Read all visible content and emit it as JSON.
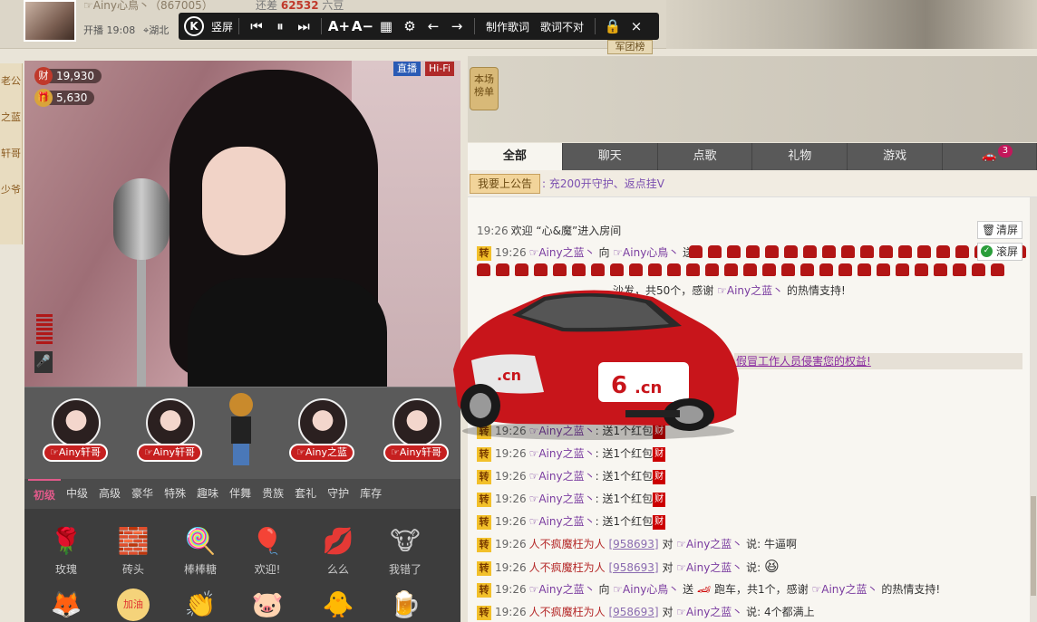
{
  "header": {
    "host_name": "☞Ainy心鳥丶（867005）",
    "open_label": "开播",
    "open_time": "19:08",
    "location": "湖北",
    "diff_prefix": "还差",
    "diff_value": "62532",
    "diff_suffix": "六豆",
    "army_label": "军团榜"
  },
  "lyric_toolbar": {
    "k_label": "K",
    "vertical_label": "竖屏",
    "make_lyric": "制作歌词",
    "lyric_wrong": "歌词不对",
    "close": "×"
  },
  "left_strip": [
    "老公",
    "之蓝",
    "轩哥",
    "少爷"
  ],
  "video": {
    "wealth_icon": "财",
    "wealth": "19,930",
    "gift_count": "5,630",
    "live_tag": "直播",
    "hifi_tag": "Hi-Fi"
  },
  "guards": [
    {
      "name": "☞Ainy轩哥"
    },
    {
      "name": "☞Ainy轩哥"
    },
    {
      "name": "☞Ainy之蓝"
    },
    {
      "name": "☞Ainy轩哥"
    }
  ],
  "gift_tabs": [
    "初级",
    "中级",
    "高级",
    "豪华",
    "特殊",
    "趣味",
    "伴舞",
    "贵族",
    "套礼",
    "守护",
    "库存"
  ],
  "gifts_row1": [
    {
      "icon": "rose-icon",
      "glyph": "🌹",
      "label": "玫瑰"
    },
    {
      "icon": "brick-icon",
      "glyph": "🧱",
      "label": "砖头"
    },
    {
      "icon": "lollipop-icon",
      "glyph": "🍭",
      "label": "棒棒糖"
    },
    {
      "icon": "welcome-icon",
      "glyph": "🎈",
      "label": "欢迎!"
    },
    {
      "icon": "kiss-icon",
      "glyph": "💋",
      "label": "么么"
    },
    {
      "icon": "cow-icon",
      "glyph": "🐮",
      "label": "我错了"
    }
  ],
  "gifts_row2": [
    {
      "icon": "fox-icon",
      "glyph": "🦊"
    },
    {
      "icon": "cheer-icon",
      "glyph": "加油"
    },
    {
      "icon": "clap-icon",
      "glyph": "👏"
    },
    {
      "icon": "pig-icon",
      "glyph": "🐷"
    },
    {
      "icon": "duck-icon",
      "glyph": "🐥"
    },
    {
      "icon": "beer-icon",
      "glyph": "🍺"
    }
  ],
  "right": {
    "rank_label": "本场榜单",
    "tabs": [
      "全部",
      "聊天",
      "点歌",
      "礼物",
      "游戏"
    ],
    "car_count": "3",
    "announce_btn": "我要上公告",
    "announce_text": "充200开守护、返点挂V",
    "clear_btn": "清屏",
    "scroll_btn": "滚屏",
    "warning": "假冒工作人员侵害您的权益!"
  },
  "chat": {
    "welcome": {
      "time": "19:26",
      "text": "欢迎 “心&魔”进入房间"
    },
    "seat_send": {
      "zhuan": "转",
      "time": "19:26",
      "from": "☞Ainy之蓝丶",
      "to_word": "向",
      "to": "☞Ainy心鳥丶",
      "send": "送"
    },
    "seat_summary": {
      "text_a": "沙发，共50个，感谢",
      "user": "☞Ainy之蓝丶",
      "text_b": "的热情支持!"
    },
    "redpack_lines": [
      {
        "zhuan": "转",
        "time": "19:26",
        "user": "☞Ainy之蓝丶",
        "text": "送1个红包",
        "cai": "财"
      },
      {
        "zhuan": "转",
        "time": "19:26",
        "user": "☞Ainy之蓝丶",
        "text": "送1个红包",
        "cai": "财"
      },
      {
        "zhuan": "转",
        "time": "19:26",
        "user": "☞Ainy之蓝丶",
        "text": "送1个红包",
        "cai": "财"
      },
      {
        "zhuan": "转",
        "time": "19:26",
        "user": "☞Ainy之蓝丶",
        "text": "送1个红包",
        "cai": "财"
      },
      {
        "zhuan": "转",
        "time": "19:26",
        "user": "☞Ainy之蓝丶",
        "text": "送1个红包",
        "cai": "财"
      }
    ],
    "msg1": {
      "zhuan": "转",
      "time": "19:26",
      "from": "人不疯魔枉为人",
      "uid": "[958693]",
      "dui": "对",
      "to": "☞Ainy之蓝丶",
      "say": "说:",
      "text": "牛逼啊"
    },
    "msg2": {
      "zhuan": "转",
      "time": "19:26",
      "from": "人不疯魔枉为人",
      "uid": "[958693]",
      "dui": "对",
      "to": "☞Ainy之蓝丶",
      "say": "说:",
      "emoji": "😆"
    },
    "car_gift": {
      "zhuan": "转",
      "time": "19:26",
      "from": "☞Ainy之蓝丶",
      "xiang": "向",
      "to": "☞Ainy心鳥丶",
      "send": "送",
      "item": "跑车，共1个，感谢",
      "thanks_user": "☞Ainy之蓝丶",
      "tail": "的热情支持!"
    },
    "msg3": {
      "zhuan": "转",
      "time": "19:26",
      "from": "人不疯魔枉为人",
      "uid": "[958693]",
      "dui": "对",
      "to": "☞Ainy之蓝丶",
      "say": "说:",
      "text": "4个都满上"
    }
  },
  "colors": {
    "accent": "#c62020",
    "tab_active": "#e05a8a",
    "user": "#7a3ca0"
  }
}
